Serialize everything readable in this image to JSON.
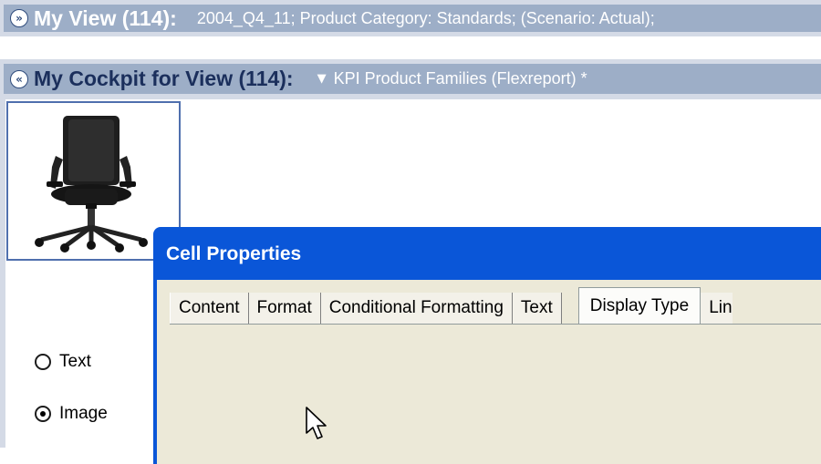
{
  "view_bar": {
    "icon": "double-chevron-down-icon",
    "title": "My View (114):",
    "description": "2004_Q4_11; Product Category: Standards; (Scenario: Actual);"
  },
  "cockpit_bar": {
    "icon": "double-chevron-up-icon",
    "title": "My Cockpit for View (114):",
    "report_icon": "dropdown-triangle-icon",
    "report_name": "KPI Product Families (Flexreport) *"
  },
  "image_cell": {
    "image": "office-chair"
  },
  "dialog": {
    "title": "Cell Properties",
    "tabs": [
      "Content",
      "Format",
      "Conditional Formatting",
      "Text",
      "Display Type",
      "Lin"
    ],
    "active_tab": "Display Type",
    "options": [
      {
        "label": "Text",
        "checked": false
      },
      {
        "label": "Image",
        "checked": true
      }
    ]
  },
  "colors": {
    "bar_background": "#9daec7",
    "bar_frame": "#d4dae6",
    "dialog_titlebar": "#0a56d8",
    "dialog_body": "#ece9d8",
    "cockpit_title": "#1b2f5c"
  }
}
